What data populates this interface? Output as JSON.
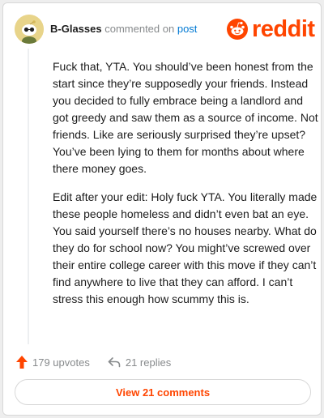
{
  "header": {
    "username": "B-Glasses",
    "commented_on": "commented on",
    "post_link": "post"
  },
  "logo": {
    "text": "reddit",
    "color": "#ff4500"
  },
  "comment": {
    "paragraphs": [
      "Fuck that, YTA. You should’ve been honest from the start since they’re supposedly your friends. Instead you decided to fully embrace being a landlord and got greedy and saw them as a source of income. Not friends. Like are seriously surprised they’re upset? You’ve been lying to them for months about where there money goes.",
      "Edit after your edit: Holy fuck YTA. You literally made these people homeless and didn’t even bat an eye. You said yourself there’s no houses nearby. What do they do for school now? You might’ve screwed over their entire college career with this move if they can’t find anywhere to live that they can afford. I can’t stress this enough how scummy this is."
    ]
  },
  "actions": {
    "upvotes": "179 upvotes",
    "replies": "21 replies"
  },
  "view_button": "View 21 comments",
  "icons": {
    "avatar": "snoo-avatar",
    "logo": "reddit-snoo-icon",
    "upvote": "upvote-arrow-icon",
    "reply": "reply-arrow-icon"
  },
  "colors": {
    "brand": "#ff4500",
    "link": "#0079d3",
    "muted": "#878a8c",
    "text": "#1c1c1c"
  }
}
